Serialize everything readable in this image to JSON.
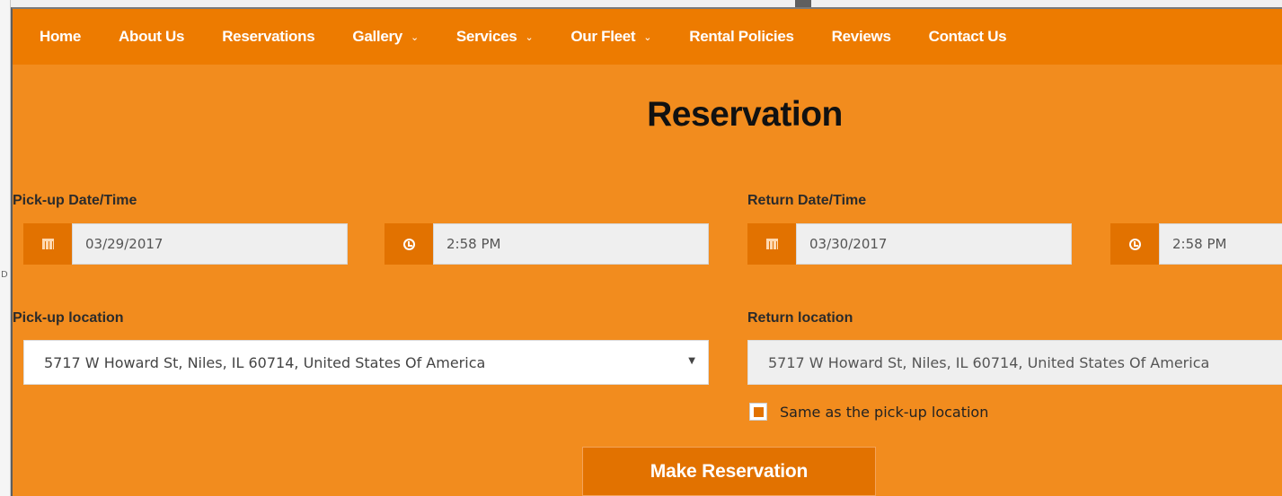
{
  "nav": {
    "items": [
      {
        "label": "Home",
        "dropdown": false
      },
      {
        "label": "About Us",
        "dropdown": false
      },
      {
        "label": "Reservations",
        "dropdown": false
      },
      {
        "label": "Gallery",
        "dropdown": true
      },
      {
        "label": "Services",
        "dropdown": true
      },
      {
        "label": "Our Fleet",
        "dropdown": true
      },
      {
        "label": "Rental Policies",
        "dropdown": false
      },
      {
        "label": "Reviews",
        "dropdown": false
      },
      {
        "label": "Contact Us",
        "dropdown": false
      }
    ],
    "chevron": "⌄"
  },
  "page_title": "Reservation",
  "pickup": {
    "label": "Pick-up Date/Time",
    "date": "03/29/2017",
    "time": "2:58 PM",
    "location_label": "Pick-up location",
    "location": "5717 W Howard St, Niles, IL 60714, United States Of America"
  },
  "return": {
    "label": "Return Date/Time",
    "date": "03/30/2017",
    "time": "2:58 PM",
    "location_label": "Return location",
    "location": "5717 W Howard St, Niles, IL 60714, United States Of America"
  },
  "same_location": {
    "label": "Same as the pick-up location",
    "checked": true
  },
  "submit_label": "Make Reservation",
  "background_fragment": "D",
  "icons": {
    "date": "calendar-icon",
    "time": "clock-icon",
    "select_arrow": "▼"
  },
  "colors": {
    "nav_bg": "#ed7b00",
    "panel_bg": "#f28c1e",
    "accent": "#e27200"
  }
}
